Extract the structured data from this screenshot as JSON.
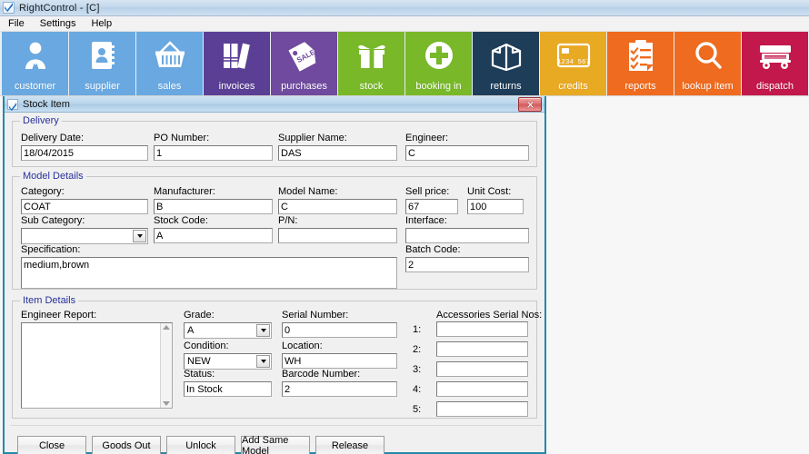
{
  "window": {
    "title": "RightControl - [C]",
    "app_icon": "checkmark-icon"
  },
  "menubar": {
    "items": [
      {
        "label": "File"
      },
      {
        "label": "Settings"
      },
      {
        "label": "Help"
      }
    ]
  },
  "toolbar": {
    "buttons": [
      {
        "label": "customer",
        "icon": "person-suit-icon",
        "color": "#69a8e0"
      },
      {
        "label": "supplier",
        "icon": "contact-card-icon",
        "color": "#69a8e0"
      },
      {
        "label": "sales",
        "icon": "basket-icon",
        "color": "#69a8e0"
      },
      {
        "label": "invoices",
        "icon": "books-icon",
        "color": "#5b3f95"
      },
      {
        "label": "purchases",
        "icon": "sale-tag-icon",
        "color": "#6f4a9e"
      },
      {
        "label": "stock",
        "icon": "gift-box-icon",
        "color": "#78b829"
      },
      {
        "label": "booking in",
        "icon": "plus-circle-icon",
        "color": "#78b829"
      },
      {
        "label": "returns",
        "icon": "open-box-icon",
        "color": "#1e3d59"
      },
      {
        "label": "credits",
        "icon": "credit-card-icon",
        "color": "#e8a923"
      },
      {
        "label": "reports",
        "icon": "clipboard-check-icon",
        "color": "#ef6b1f"
      },
      {
        "label": "lookup item",
        "icon": "magnifier-icon",
        "color": "#ef6b1f"
      },
      {
        "label": "dispatch",
        "icon": "truck-icon",
        "color": "#c2184b"
      }
    ]
  },
  "dialog": {
    "title": "Stock Item",
    "icon": "checkmark-icon",
    "close_label": "✕",
    "accent_border": "#2389a8",
    "delivery": {
      "legend": "Delivery",
      "fields": {
        "delivery_date_label": "Delivery Date:",
        "delivery_date_value": "18/04/2015",
        "po_number_label": "PO Number:",
        "po_number_value": "1",
        "supplier_name_label": "Supplier Name:",
        "supplier_name_value": "DAS",
        "engineer_label": "Engineer:",
        "engineer_value": "C"
      }
    },
    "model_details": {
      "legend": "Model Details",
      "fields": {
        "category_label": "Category:",
        "category_value": "COAT",
        "manufacturer_label": "Manufacturer:",
        "manufacturer_value": "B",
        "model_name_label": "Model Name:",
        "model_name_value": "C",
        "sell_price_label": "Sell price:",
        "sell_price_value": "67",
        "unit_cost_label": "Unit Cost:",
        "unit_cost_value": "100",
        "sub_category_label": "Sub Category:",
        "sub_category_value": "",
        "stock_code_label": "Stock Code:",
        "stock_code_value": "A",
        "pn_label": "P/N:",
        "pn_value": "",
        "interface_label": "Interface:",
        "interface_value": "",
        "specification_label": "Specification:",
        "specification_value": "medium,brown",
        "batch_code_label": "Batch Code:",
        "batch_code_value": "2"
      }
    },
    "item_details": {
      "legend": "Item Details",
      "fields": {
        "engineer_report_label": "Engineer Report:",
        "engineer_report_value": "",
        "grade_label": "Grade:",
        "grade_value": "A",
        "condition_label": "Condition:",
        "condition_value": "NEW",
        "status_label": "Status:",
        "status_value": "In Stock",
        "serial_number_label": "Serial Number:",
        "serial_number_value": "0",
        "location_label": "Location:",
        "location_value": "WH",
        "barcode_number_label": "Barcode Number:",
        "barcode_number_value": "2",
        "accessories_label": "Accessories Serial Nos:"
      },
      "accessories": [
        {
          "index": "1:",
          "value": ""
        },
        {
          "index": "2:",
          "value": ""
        },
        {
          "index": "3:",
          "value": ""
        },
        {
          "index": "4:",
          "value": ""
        },
        {
          "index": "5:",
          "value": ""
        }
      ]
    },
    "buttons": [
      {
        "label": "Close"
      },
      {
        "label": "Goods Out"
      },
      {
        "label": "Unlock"
      },
      {
        "label": "Add Same Model"
      },
      {
        "label": "Release"
      }
    ]
  }
}
